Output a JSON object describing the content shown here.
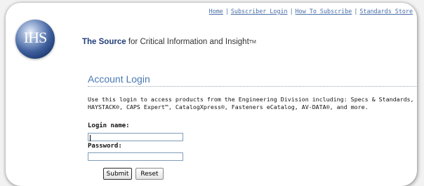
{
  "nav": {
    "links": [
      "Home",
      "Subscriber Login",
      "How To Subscribe",
      "Standards Store"
    ],
    "separator": "|"
  },
  "logo": {
    "text": "IHS"
  },
  "tagline": {
    "brand": "The Source",
    "rest": " for Critical Information and Insight",
    "tm": "TM"
  },
  "login": {
    "title": "Account Login",
    "intro_line1": "Use this login to access products from the Engineering Division including:  Specs & Standards,",
    "intro_line2": "HAYSTACK®, CAPS Expert™, CatalogXpress®, Fasteners eCatalog, AV-DATA®, and more.",
    "login_name_label": "Login name:",
    "login_name_value": "",
    "password_label": "Password:",
    "password_value": "",
    "submit_label": "Submit",
    "reset_label": "Reset"
  },
  "colors": {
    "link": "#4a6fa8",
    "title": "#4a79b3",
    "brand": "#1f3d78",
    "logo": "#2a4b86"
  }
}
